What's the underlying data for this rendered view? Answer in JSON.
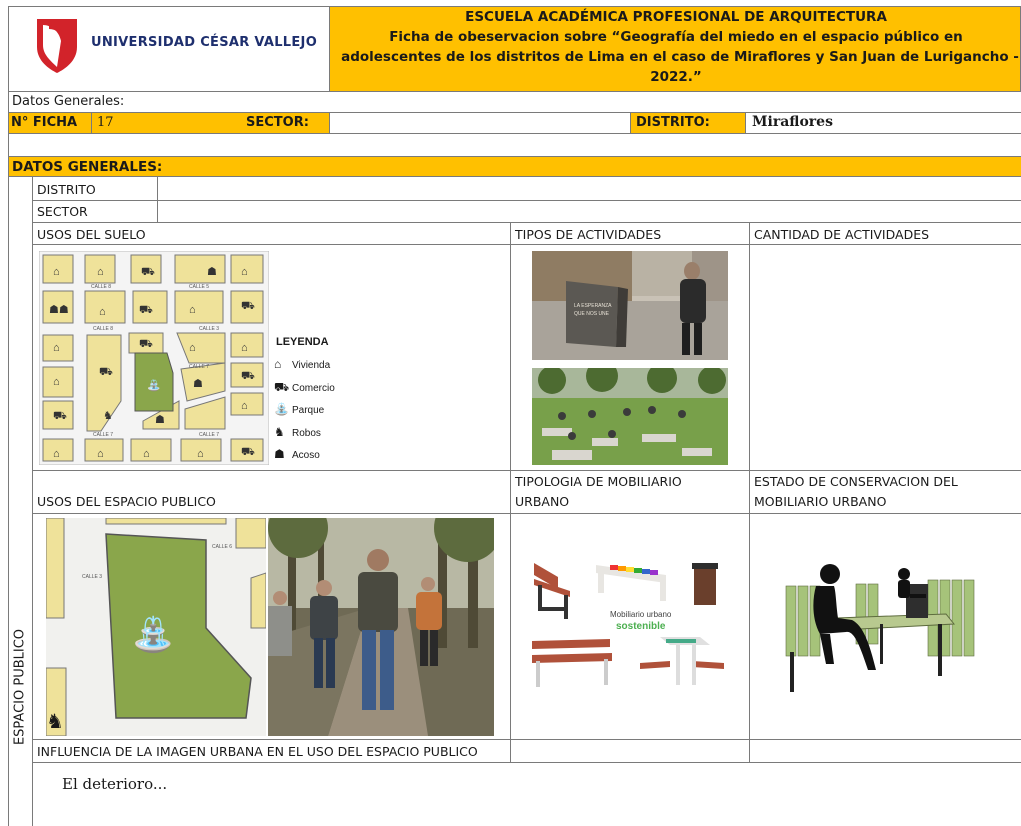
{
  "header": {
    "university_name": "UNIVERSIDAD CÉSAR VALLEJO",
    "school": "ESCUELA ACADÉMICA PROFESIONAL DE ARQUITECTURA",
    "form_title_line1": "Ficha de obeservacion sobre  “Geografía del miedo en el espacio público en",
    "form_title_line2": "adolescentes de los distritos de Lima en el caso de Miraflores y San Juan de Lurigancho -",
    "form_title_line3": "2022.”"
  },
  "general_row": {
    "label": "Datos Generales:",
    "ficha_label": "N° FICHA",
    "ficha_value": "17",
    "sector_label": "SECTOR:",
    "sector_value": "",
    "distrito_label": "DISTRITO:",
    "distrito_value": "Miraflores"
  },
  "datos_generales": {
    "title": "DATOS GENERALES:",
    "side_label": "ESPACIO PUBLICO",
    "distrito_label": "DISTRITO",
    "sector_label": "SECTOR",
    "usos_suelo": "USOS DEL SUELO",
    "tipos_actividades": "TIPOS DE ACTIVIDADES",
    "cantidad_actividades": "CANTIDAD DE ACTIVIDADES",
    "usos_espacio": "USOS DEL ESPACIO PUBLICO",
    "tipologia_line1": "TIPOLOGIA DE MOBILIARIO",
    "tipologia_line2": "URBANO",
    "estado_line1": "ESTADO DE CONSERVACION DEL",
    "estado_line2": "MOBILIARIO URBANO",
    "influencia": "INFLUENCIA DE LA IMAGEN URBANA EN EL USO DEL ESPACIO PUBLICO",
    "influencia_text": "El deterioro..."
  },
  "legend": {
    "title": "LEYENDA",
    "items": [
      "Vivienda",
      "Comercio",
      "Parque",
      "Robos",
      "Acoso"
    ]
  },
  "map_streets": [
    "CALLE 8",
    "CALLE 4",
    "CALLE 5",
    "CALLE 6",
    "CALLE 3",
    "CALLE 7"
  ],
  "furniture_caption_line1": "Mobiliario urbano",
  "furniture_caption_line2": "sostenible",
  "colors": {
    "header_gold": "#ffc000",
    "block_fill": "#efe29a",
    "park_fill": "#8aa64b",
    "grid_line": "#7a7a7a"
  }
}
